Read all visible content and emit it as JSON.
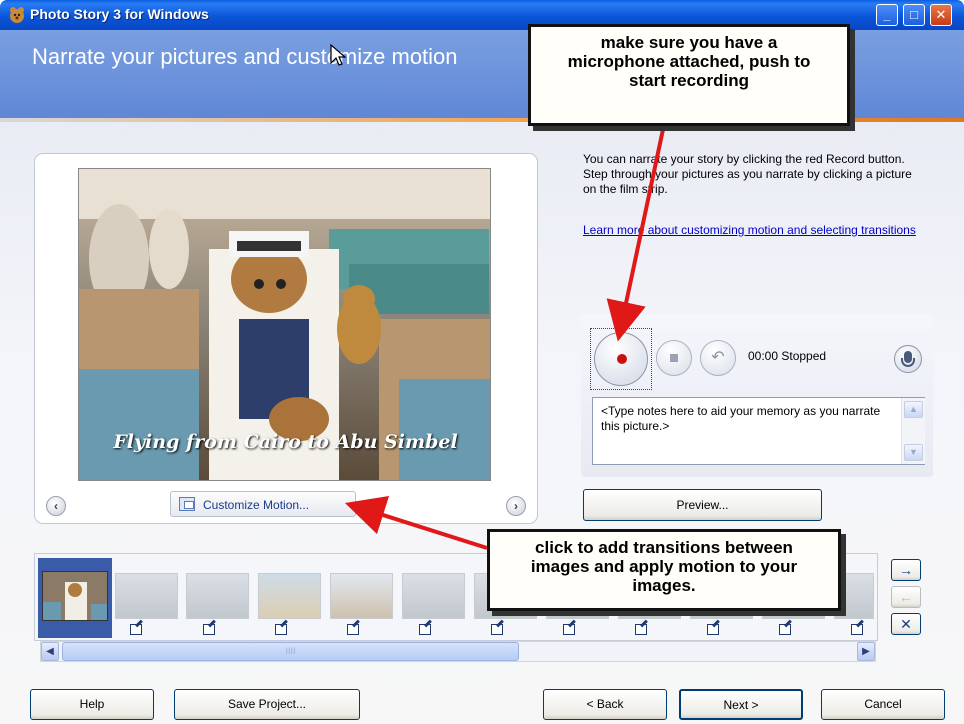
{
  "window": {
    "title": "Photo Story 3 for Windows",
    "minimize_glyph": "_",
    "maximize_glyph": "□",
    "close_glyph": "✕"
  },
  "header": {
    "title": "Narrate your pictures and customize motion"
  },
  "preview": {
    "photo_caption": "Flying from Cairo to Abu Simbel",
    "customize_motion_label": "Customize Motion...",
    "prev_glyph": "‹",
    "next_glyph": "›"
  },
  "narration": {
    "description": "You can narrate your story by clicking the red Record button. Step through your pictures as you narrate by clicking a picture on the film strip.",
    "learn_more_link": "Learn more about customizing motion and selecting transitions",
    "time": "00:00",
    "status": "Stopped",
    "notes_placeholder": "<Type notes here to aid your memory as you narrate this picture.>",
    "preview_button": "Preview..."
  },
  "filmstrip": {
    "thumb_count": 11,
    "scroll_grip": "IIII",
    "side_buttons": [
      "→",
      "←",
      "✕"
    ]
  },
  "footer": {
    "help": "Help",
    "save_project": "Save Project...",
    "back": "< Back",
    "next": "Next >",
    "cancel": "Cancel"
  },
  "annotations": {
    "top": [
      "make sure you have a",
      "microphone attached, push to",
      "start recording"
    ],
    "bottom": [
      "click to add transitions between",
      "images and apply motion to your",
      "images."
    ]
  },
  "colors": {
    "titlebar": "#0a56d8",
    "header": "#6e94dc",
    "record": "#c81010",
    "arrow": "#e01818"
  }
}
